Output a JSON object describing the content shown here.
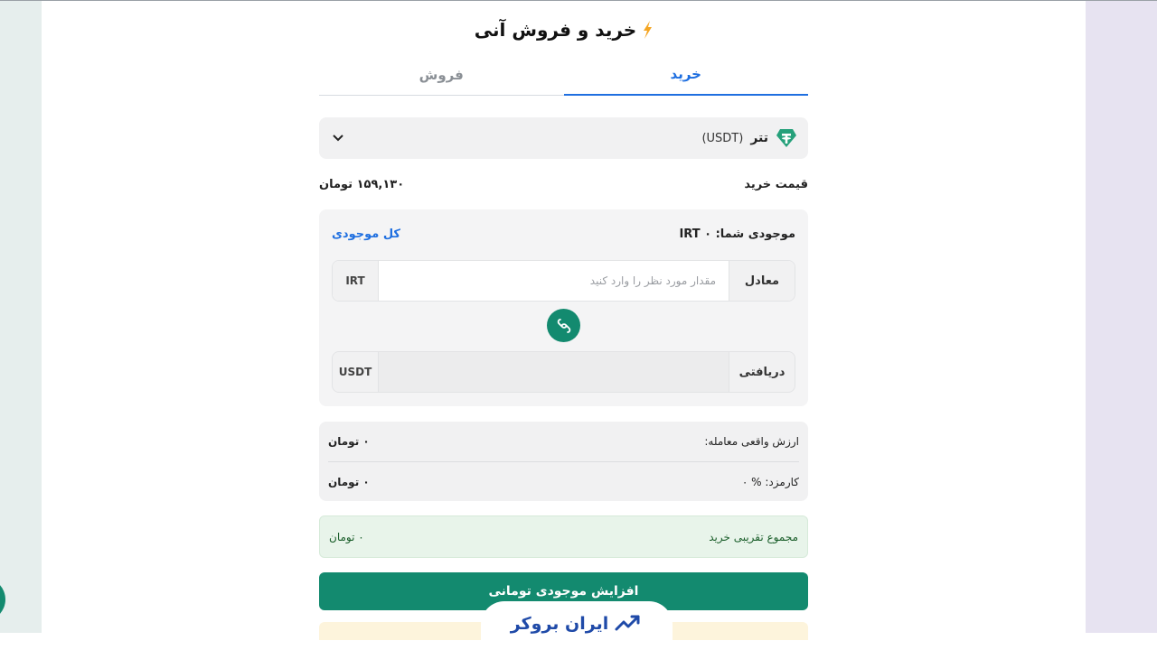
{
  "header": {
    "title": "خرید و فروش آنی"
  },
  "tabs": [
    {
      "label": "خرید",
      "active": true
    },
    {
      "label": "فروش",
      "active": false
    }
  ],
  "asset_select": {
    "name": "تتر",
    "code": "(USDT)",
    "icon": "tether-icon"
  },
  "price": {
    "label": "قیمت خرید",
    "value": "۱۵۹,۱۳۰ تومان"
  },
  "balance": {
    "label": "موجودی شما: IRT ۰",
    "all_link": "کل موجودی"
  },
  "pay_field": {
    "label": "معادل",
    "placeholder": "مقدار مورد نظر را وارد کنید",
    "currency": "IRT",
    "value": ""
  },
  "receive_field": {
    "label": "دریافتی",
    "currency": "USDT",
    "value": ""
  },
  "summary": {
    "real_value_label": "ارزش واقعی معامله:",
    "real_value": "۰ تومان",
    "fee_label": "کارمزد:  % ۰",
    "fee_value": "۰ تومان"
  },
  "total": {
    "label": "مجموع تقریبی خرید",
    "value": "۰ تومان"
  },
  "cta": {
    "label": "افزایش موجودی تومانی"
  },
  "brand": {
    "name": "ایران بروکر"
  },
  "colors": {
    "accent": "#1f6fe0",
    "primary": "#138a6f",
    "tether": "#26a17b",
    "bolt": "#f5a623"
  }
}
